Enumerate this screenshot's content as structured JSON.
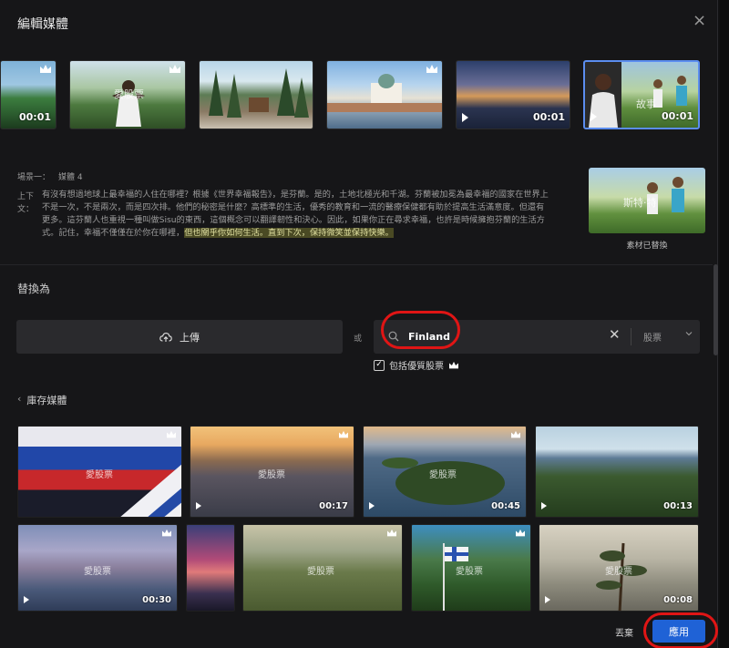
{
  "dialog": {
    "title": "編輯媒體",
    "close_glyph": "×"
  },
  "scene_strip": {
    "thumbs": [
      {
        "duration": "00:01",
        "watermark": "",
        "premium": true,
        "play": false
      },
      {
        "duration": "",
        "watermark": "愛股票",
        "premium": true,
        "play": false
      },
      {
        "duration": "",
        "watermark": "",
        "premium": false,
        "play": false
      },
      {
        "duration": "",
        "watermark": "",
        "premium": true,
        "play": false
      },
      {
        "duration": "00:01",
        "watermark": "",
        "premium": false,
        "play": true
      },
      {
        "duration": "00:01",
        "watermark": "故事",
        "premium": false,
        "play": true,
        "selected": true
      }
    ]
  },
  "scene_info": {
    "scene_label": "場景一：",
    "media_label": "媒體 4",
    "context_label": "上下文：",
    "context_text": "有沒有想過地球上最幸福的人住在哪裡？根據《世界幸福報告》，是芬蘭。是的，土地北極光和千湖。芬蘭被加冕為最幸福的國家在世界上不是一次，不是兩次，而是四次排。他們的秘密是什麼？高標準的生活，優秀的教育和一流的醫療保健都有助於提高生活滿意度。但還有更多。這芬蘭人也重視一種叫做Sisu的東西，這個概念可以翻譯韌性和決心。因此，如果你正在尋求幸福，也許是時候擁抱芬蘭的生活方式。記住，幸福不僅僅在於你在哪裡，",
    "context_highlight": "但也關乎你如何生活。直到下次，保持微笑並保持快樂。",
    "replaced_watermark": "斯特·特",
    "replaced_label": "素材已替換"
  },
  "replace": {
    "title": "替換為",
    "upload_label": "上傳",
    "or_label": "或",
    "search_value": "Finland",
    "clear_glyph": "✕",
    "source_dropdown": "股票",
    "premium_label": "包括優質股票",
    "premium_checked": "✓"
  },
  "stock": {
    "heading": "庫存媒體",
    "chevron": "‹",
    "row1": [
      {
        "duration": "",
        "watermark": "愛股票",
        "premium": true
      },
      {
        "duration": "00:17",
        "watermark": "愛股票",
        "premium": true
      },
      {
        "duration": "00:45",
        "watermark": "愛股票",
        "premium": true
      },
      {
        "duration": "00:13",
        "watermark": "",
        "premium": false
      }
    ],
    "row2": [
      {
        "duration": "00:30",
        "watermark": "愛股票",
        "premium": true
      },
      {
        "duration": "",
        "watermark": "",
        "premium": false
      },
      {
        "duration": "",
        "watermark": "愛股票",
        "premium": true
      },
      {
        "duration": "",
        "watermark": "愛股票",
        "premium": true
      },
      {
        "duration": "00:08",
        "watermark": "愛股票",
        "premium": false
      }
    ]
  },
  "footer": {
    "discard_label": "丟棄",
    "apply_label": "應用"
  },
  "colors": {
    "accent": "#1f62d6",
    "annotation": "#e01515",
    "selected_border": "#5b8def"
  }
}
